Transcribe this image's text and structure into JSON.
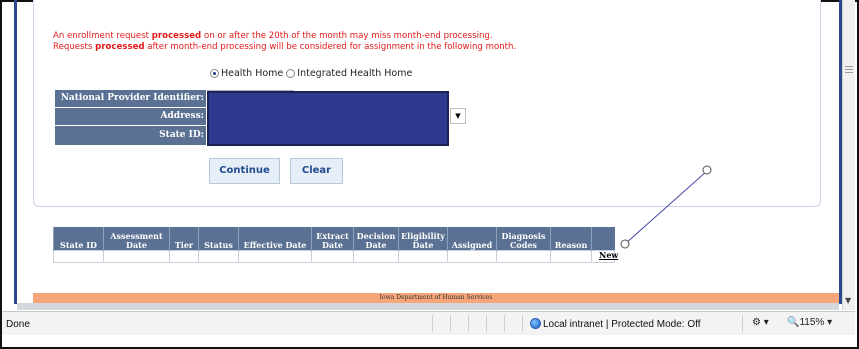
{
  "warning": {
    "line1_pre": "An enrollment request ",
    "line1_bold": "processed",
    "line1_post": " on or after the 20th of the month may miss month-end processing.",
    "line2_pre": "Requests ",
    "line2_bold": "processed",
    "line2_post": " after month-end processing will be considered for assignment in the following month."
  },
  "program_options": [
    {
      "label": "Health Home",
      "checked": true
    },
    {
      "label": "Integrated Health Home",
      "checked": false
    }
  ],
  "form": {
    "npi_label": "National Provider Identifier:",
    "address_label": "Address:",
    "state_id_label": "State ID:"
  },
  "buttons": {
    "continue": "Continue",
    "clear": "Clear"
  },
  "results_table": {
    "headers": [
      "State ID",
      "Assessment Date",
      "Tier",
      "Status",
      "Effective Date",
      "Extract Date",
      "Decision Date",
      "Eligibility Date",
      "Assigned",
      "Diagnosis Codes",
      "Reason"
    ],
    "new_link": "New"
  },
  "footer": {
    "agency": "Iowa Department of Human Services"
  },
  "statusbar": {
    "status": "Done",
    "zone": "Local intranet | Protected Mode: Off",
    "zoom": "115%"
  },
  "colors": {
    "header_bg": "#5b7193",
    "warning_red": "#e21a1a",
    "redaction": "#2e3a8e",
    "footer_orange": "#f7a679"
  }
}
